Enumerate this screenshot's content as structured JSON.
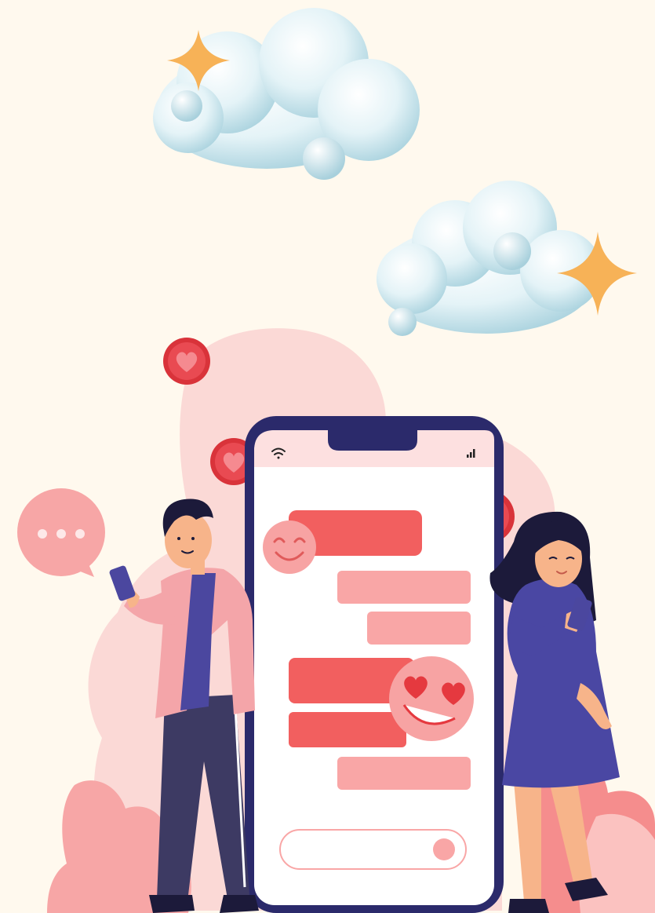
{
  "illustration": {
    "subject": "online-dating-chat",
    "palette": {
      "background": "#fff9ee",
      "cloud_light": "#eef8fb",
      "cloud_shadow": "#b9dbe5",
      "sparkle": "#f7b257",
      "blob": "#fbd9d6",
      "heart_badge": "#d9333a",
      "heart_inner": "#f06a72",
      "phone_frame": "#2b2a6b",
      "phone_screen": "#ffffff",
      "status_bar": "#fde0e0",
      "bubble_dark": "#f25f5f",
      "bubble_light": "#f9a6a6",
      "emoji_face": "#f7a3a3",
      "man_jacket": "#f4a5a9",
      "man_shirt": "#4b479f",
      "man_pants": "#3d3a63",
      "woman_dress": "#4a47a3",
      "skin": "#f7b48a",
      "hair": "#1c1a3a"
    },
    "icons": [
      "wifi-icon",
      "signal-icon",
      "heart-icon",
      "smile-emoji-icon",
      "heart-eyes-emoji-icon",
      "speech-bubble-ellipsis-icon",
      "sparkle-icon",
      "cloud-icon"
    ],
    "chat_bubble_counts": {
      "sent": 3,
      "received": 3
    }
  }
}
